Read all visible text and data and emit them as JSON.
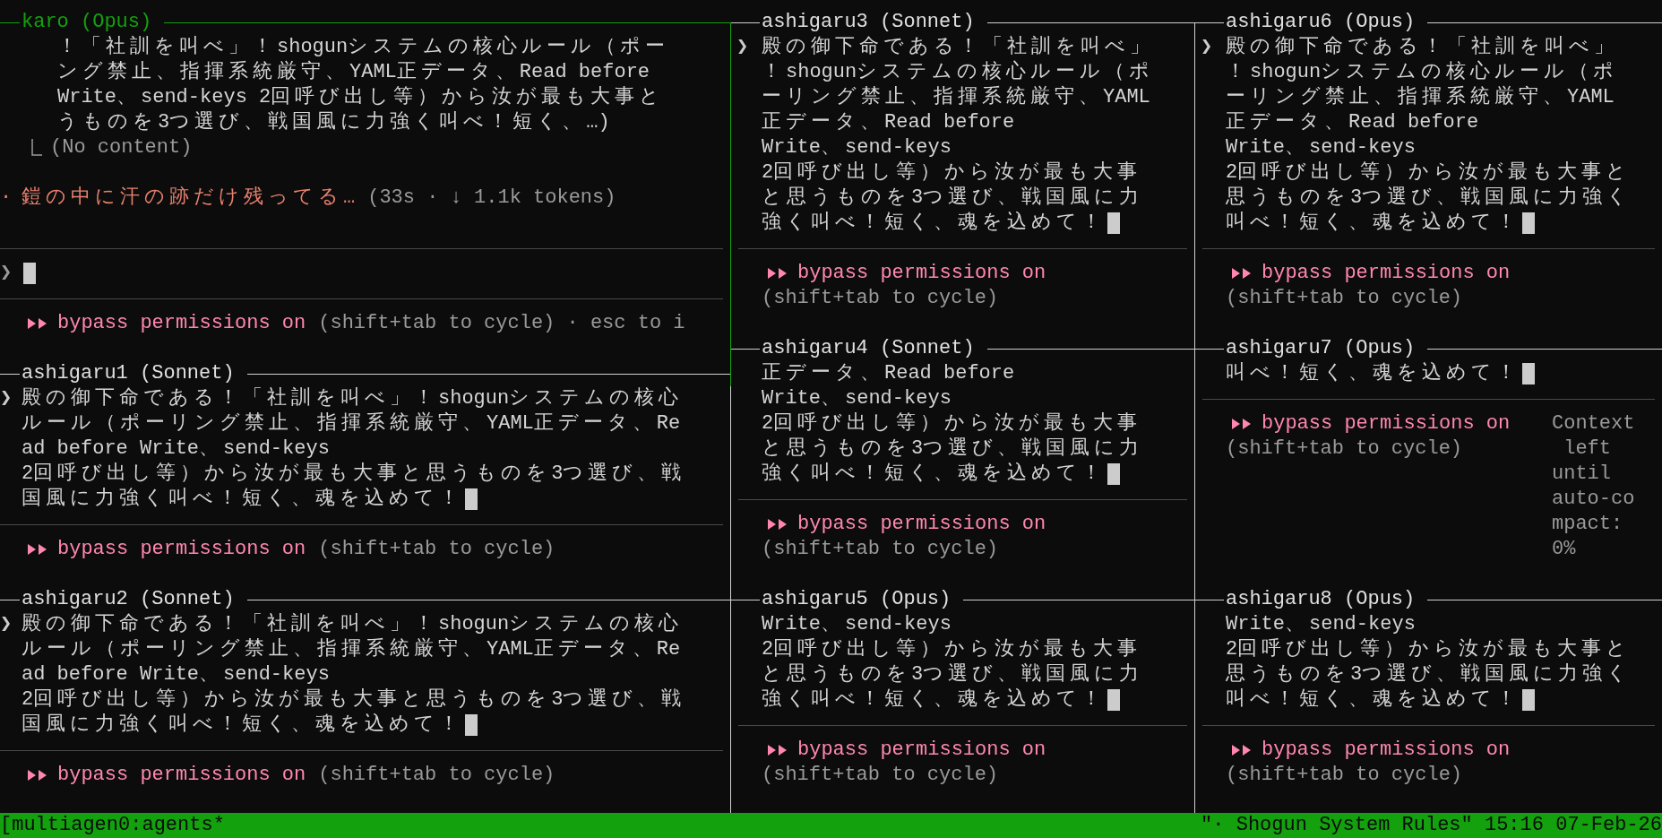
{
  "columns": [
    {
      "panes": [
        {
          "title": "karo (Opus)",
          "active": true,
          "lines": [
            {
              "kind": "quote",
              "text": "！「社訓を叫べ」！shogunシステムの核心ルール（ポー"
            },
            {
              "kind": "quote",
              "text": "ング禁止、指揮系統厳守、YAML正データ、Read before"
            },
            {
              "kind": "quote",
              "text": "Write、send-keys 2回呼び出し等）から汝が最も大事と"
            },
            {
              "kind": "quote",
              "text": "うものを3つ選び、戦国風に力強く叫べ！短く、…)"
            },
            {
              "kind": "result",
              "text": "(No content)"
            },
            {
              "kind": "blank"
            },
            {
              "kind": "status",
              "marker": "·",
              "text": "鎧の中に汗の跡だけ残ってる…",
              "detail": "(33s · ↓ 1.1k tokens)"
            },
            {
              "kind": "blank"
            },
            {
              "kind": "separator"
            },
            {
              "kind": "input",
              "marker": "❯"
            },
            {
              "kind": "separator"
            },
            {
              "kind": "mode",
              "label": "bypass permissions on",
              "hint": "(shift+tab to cycle) · esc to i"
            }
          ]
        },
        {
          "title": "ashigaru1 (Sonnet)",
          "active": false,
          "lines": [
            {
              "kind": "message",
              "marker": "❯",
              "text": "殿の御下命である！「社訓を叫べ」！shogunシステムの核心",
              "cursor": false
            },
            {
              "kind": "message",
              "text": "ルール（ポーリング禁止、指揮系統厳守、YAML正データ、Re",
              "cursor": false
            },
            {
              "kind": "message",
              "text": "ad before Write、send-keys",
              "cursor": false
            },
            {
              "kind": "message",
              "text": "2回呼び出し等）から汝が最も大事と思うものを3つ選び、戦",
              "cursor": false
            },
            {
              "kind": "message",
              "text": "国風に力強く叫べ！短く、魂を込めて！",
              "cursor": true
            },
            {
              "kind": "separator"
            },
            {
              "kind": "mode",
              "label": "bypass permissions on",
              "hint": "(shift+tab to cycle)"
            }
          ]
        },
        {
          "title": "ashigaru2 (Sonnet)",
          "active": false,
          "lines": [
            {
              "kind": "message",
              "marker": "❯",
              "text": "殿の御下命である！「社訓を叫べ」！shogunシステムの核心",
              "cursor": false
            },
            {
              "kind": "message",
              "text": "ルール（ポーリング禁止、指揮系統厳守、YAML正データ、Re",
              "cursor": false
            },
            {
              "kind": "message",
              "text": "ad before Write、send-keys",
              "cursor": false
            },
            {
              "kind": "message",
              "text": "2回呼び出し等）から汝が最も大事と思うものを3つ選び、戦",
              "cursor": false
            },
            {
              "kind": "message",
              "text": "国風に力強く叫べ！短く、魂を込めて！",
              "cursor": true
            },
            {
              "kind": "separator"
            },
            {
              "kind": "mode",
              "label": "bypass permissions on",
              "hint": "(shift+tab to cycle)"
            }
          ]
        }
      ]
    },
    {
      "panes": [
        {
          "title": "ashigaru3 (Sonnet)",
          "active": false,
          "lines": [
            {
              "kind": "message",
              "marker": "❯",
              "text": "殿の御下命である！「社訓を叫べ」",
              "cursor": false
            },
            {
              "kind": "message",
              "text": "！shogunシステムの核心ルール（ポ",
              "cursor": false
            },
            {
              "kind": "message",
              "text": "ーリング禁止、指揮系統厳守、YAML",
              "cursor": false
            },
            {
              "kind": "message",
              "text": "正データ、Read before",
              "cursor": false
            },
            {
              "kind": "message",
              "text": "Write、send-keys",
              "cursor": false
            },
            {
              "kind": "message",
              "text": "2回呼び出し等）から汝が最も大事",
              "cursor": false
            },
            {
              "kind": "message",
              "text": "と思うものを3つ選び、戦国風に力",
              "cursor": false
            },
            {
              "kind": "message",
              "text": "強く叫べ！短く、魂を込めて！",
              "cursor": true
            },
            {
              "kind": "separator"
            },
            {
              "kind": "mode",
              "label": "bypass permissions on"
            },
            {
              "kind": "hint",
              "text": "(shift+tab to cycle)"
            }
          ]
        },
        {
          "title": "ashigaru4 (Sonnet)",
          "active": false,
          "lines": [
            {
              "kind": "message",
              "text": "正データ、Read before",
              "cursor": false
            },
            {
              "kind": "message",
              "text": "Write、send-keys",
              "cursor": false
            },
            {
              "kind": "message",
              "text": "2回呼び出し等）から汝が最も大事",
              "cursor": false
            },
            {
              "kind": "message",
              "text": "と思うものを3つ選び、戦国風に力",
              "cursor": false
            },
            {
              "kind": "message",
              "text": "強く叫べ！短く、魂を込めて！",
              "cursor": true
            },
            {
              "kind": "separator"
            },
            {
              "kind": "mode",
              "label": "bypass permissions on"
            },
            {
              "kind": "hint",
              "text": "(shift+tab to cycle)"
            }
          ]
        },
        {
          "title": "ashigaru5 (Opus)",
          "active": false,
          "lines": [
            {
              "kind": "message",
              "text": "Write、send-keys",
              "cursor": false
            },
            {
              "kind": "message",
              "text": "2回呼び出し等）から汝が最も大事",
              "cursor": false
            },
            {
              "kind": "message",
              "text": "と思うものを3つ選び、戦国風に力",
              "cursor": false
            },
            {
              "kind": "message",
              "text": "強く叫べ！短く、魂を込めて！",
              "cursor": true
            },
            {
              "kind": "separator"
            },
            {
              "kind": "mode",
              "label": "bypass permissions on"
            },
            {
              "kind": "hint",
              "text": "(shift+tab to cycle)"
            }
          ]
        }
      ]
    },
    {
      "panes": [
        {
          "title": "ashigaru6 (Opus)",
          "active": false,
          "lines": [
            {
              "kind": "message",
              "marker": "❯",
              "text": "殿の御下命である！「社訓を叫べ」",
              "cursor": false
            },
            {
              "kind": "message",
              "text": "！shogunシステムの核心ルール（ポ",
              "cursor": false
            },
            {
              "kind": "message",
              "text": "ーリング禁止、指揮系統厳守、YAML",
              "cursor": false
            },
            {
              "kind": "message",
              "text": "正データ、Read before",
              "cursor": false
            },
            {
              "kind": "message",
              "text": "Write、send-keys",
              "cursor": false
            },
            {
              "kind": "message",
              "text": "2回呼び出し等）から汝が最も大事と",
              "cursor": false
            },
            {
              "kind": "message",
              "text": "思うものを3つ選び、戦国風に力強く",
              "cursor": false
            },
            {
              "kind": "message",
              "text": "叫べ！短く、魂を込めて！",
              "cursor": true
            },
            {
              "kind": "separator"
            },
            {
              "kind": "mode",
              "label": "bypass permissions on"
            },
            {
              "kind": "hint",
              "text": "(shift+tab to cycle)"
            }
          ]
        },
        {
          "title": "ashigaru7 (Opus)",
          "active": false,
          "lines": [
            {
              "kind": "message",
              "text": "叫べ！短く、魂を込めて！",
              "cursor": true
            },
            {
              "kind": "separator"
            },
            {
              "kind": "mode",
              "label": "bypass permissions on",
              "aside": "Context"
            },
            {
              "kind": "hint",
              "text": "(shift+tab to cycle)",
              "aside": " left"
            },
            {
              "kind": "aside",
              "text": "until"
            },
            {
              "kind": "aside",
              "text": "auto-co"
            },
            {
              "kind": "aside",
              "text": "mpact:"
            },
            {
              "kind": "aside",
              "text": "0%"
            }
          ]
        },
        {
          "title": "ashigaru8 (Opus)",
          "active": false,
          "lines": [
            {
              "kind": "message",
              "text": "Write、send-keys",
              "cursor": false
            },
            {
              "kind": "message",
              "text": "2回呼び出し等）から汝が最も大事と",
              "cursor": false
            },
            {
              "kind": "message",
              "text": "思うものを3つ選び、戦国風に力強く",
              "cursor": false
            },
            {
              "kind": "message",
              "text": "叫べ！短く、魂を込めて！",
              "cursor": true
            },
            {
              "kind": "separator"
            },
            {
              "kind": "mode",
              "label": "bypass permissions on"
            },
            {
              "kind": "hint",
              "text": "(shift+tab to cycle)"
            }
          ]
        }
      ]
    }
  ],
  "status_bar": {
    "session": "[multiagen0:agents*",
    "right": "\"· Shogun System Rules\" 15:16 07-Feb-26"
  }
}
